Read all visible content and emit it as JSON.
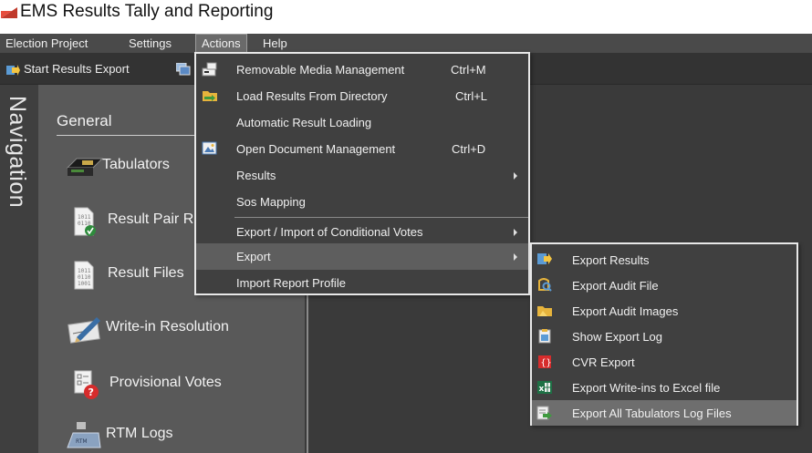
{
  "window": {
    "title": "EMS Results Tally and Reporting",
    "icon": "ems-app-icon"
  },
  "menubar": {
    "items": [
      "Election Project",
      "Settings",
      "Actions",
      "Help"
    ],
    "active": "Actions"
  },
  "toolbar": {
    "start_export_label": "Start Results Export"
  },
  "navigation": {
    "title": "Navigation",
    "section": "General",
    "items": [
      {
        "label": "Tabulators",
        "icon": "tabulator-icon"
      },
      {
        "label": "Result Pair Re",
        "icon": "result-pair-icon"
      },
      {
        "label": "Result Files",
        "icon": "result-files-icon"
      },
      {
        "label": "Write-in Resolution",
        "icon": "write-in-icon"
      },
      {
        "label": "Provisional Votes",
        "icon": "provisional-votes-icon"
      },
      {
        "label": "RTM Logs",
        "icon": "rtm-logs-icon"
      }
    ]
  },
  "actions_menu": {
    "items": [
      {
        "label": "Removable Media Management",
        "shortcut": "Ctrl+M",
        "icon": "removable-media-icon"
      },
      {
        "label": "Load Results From Directory",
        "shortcut": "Ctrl+L",
        "icon": "folder-load-icon"
      },
      {
        "label": "Automatic Result Loading",
        "shortcut": "",
        "icon": ""
      },
      {
        "label": "Open Document Management",
        "shortcut": "Ctrl+D",
        "icon": "document-management-icon"
      },
      {
        "label": "Results",
        "shortcut": "",
        "icon": "",
        "submenu": true
      },
      {
        "label": "Sos Mapping",
        "shortcut": "",
        "icon": ""
      },
      {
        "label": "Export / Import of Conditional Votes",
        "shortcut": "",
        "icon": "",
        "submenu": true
      },
      {
        "label": "Export",
        "shortcut": "",
        "icon": "",
        "submenu": true
      },
      {
        "label": "Import Report Profile",
        "shortcut": "",
        "icon": ""
      }
    ]
  },
  "export_submenu": {
    "items": [
      {
        "label": "Export Results",
        "icon": "export-results-icon"
      },
      {
        "label": "Export Audit File",
        "icon": "audit-file-icon"
      },
      {
        "label": "Export Audit Images",
        "icon": "audit-images-icon"
      },
      {
        "label": "Show Export Log",
        "icon": "export-log-icon"
      },
      {
        "label": "CVR Export",
        "icon": "cvr-export-icon"
      },
      {
        "label": "Export Write-ins to Excel file",
        "icon": "excel-icon"
      },
      {
        "label": "Export All Tabulators Log Files",
        "icon": "tabulator-logs-icon"
      }
    ]
  },
  "colors": {
    "menubar": "#4a4a4a",
    "toolbar": "#333333",
    "nav_panel": "#595959",
    "content": "#3a3a3a",
    "menu_bg": "#404040",
    "menu_border": "#e8e8e8",
    "highlight": "#5e5e5e"
  }
}
